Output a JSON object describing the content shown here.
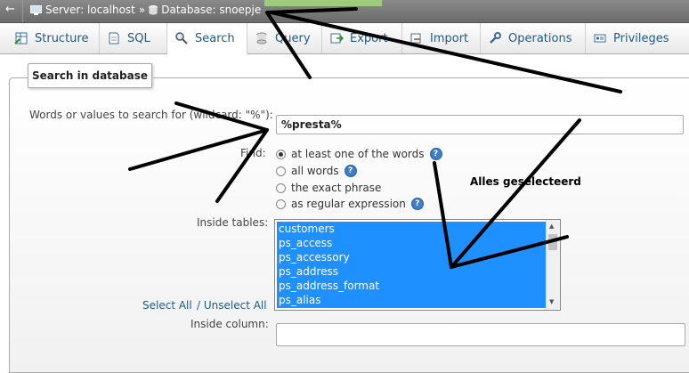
{
  "breadcrumb": {
    "back": "←",
    "server": "Server: localhost",
    "separator": "»",
    "database": "Database: snoepje"
  },
  "tabs": [
    {
      "label": "Structure",
      "icon": "structure-icon"
    },
    {
      "label": "SQL",
      "icon": "sql-icon"
    },
    {
      "label": "Search",
      "icon": "search-icon",
      "active": true
    },
    {
      "label": "Query",
      "icon": "query-icon"
    },
    {
      "label": "Export",
      "icon": "export-icon"
    },
    {
      "label": "Import",
      "icon": "import-icon"
    },
    {
      "label": "Operations",
      "icon": "wrench-icon"
    },
    {
      "label": "Privileges",
      "icon": "privileges-icon"
    }
  ],
  "form": {
    "legend": "Search in database",
    "words_label": "Words or values to search for (wildcard: \"%\"):",
    "words_value": "%presta%",
    "find_label": "Find:",
    "find_options": [
      {
        "label": "at least one of the words",
        "checked": true,
        "help": true
      },
      {
        "label": "all words",
        "checked": false,
        "help": true
      },
      {
        "label": "the exact phrase",
        "checked": false,
        "help": false
      },
      {
        "label": "as regular expression",
        "checked": false,
        "help": true
      }
    ],
    "tables_label": "Inside tables:",
    "tables": [
      "customers",
      "ps_access",
      "ps_accessory",
      "ps_address",
      "ps_address_format",
      "ps_alias"
    ],
    "select_all": "Select All",
    "unselect_all": "/ Unselect All",
    "column_label": "Inside column:",
    "column_value": ""
  },
  "annotation": {
    "text": "Alles geselecteerd"
  },
  "colors": {
    "selection": "#1e90ff",
    "link": "#235a81",
    "topbar": "#7a7a7a"
  }
}
